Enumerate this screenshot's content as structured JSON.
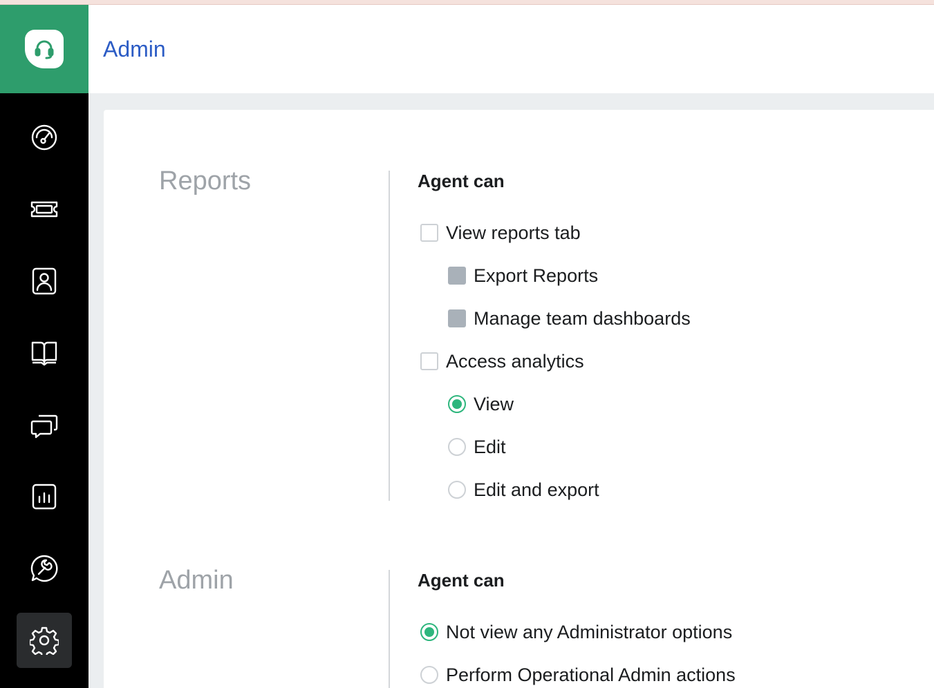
{
  "header": {
    "title": "Admin"
  },
  "sidebar": {
    "items": [
      {
        "icon": "dashboard-icon"
      },
      {
        "icon": "ticket-icon"
      },
      {
        "icon": "contacts-icon"
      },
      {
        "icon": "knowledge-base-icon"
      },
      {
        "icon": "conversations-icon"
      },
      {
        "icon": "analytics-icon"
      },
      {
        "icon": "tools-icon"
      },
      {
        "icon": "gear-icon",
        "active": true
      }
    ]
  },
  "reports_section": {
    "title": "Reports",
    "heading": "Agent can",
    "options": [
      {
        "label": "View reports tab",
        "type": "checkbox",
        "checked": false
      },
      {
        "label": "Export Reports",
        "type": "checkbox",
        "disabled": true
      },
      {
        "label": "Manage team dashboards",
        "type": "checkbox",
        "disabled": true
      },
      {
        "label": "Access analytics",
        "type": "checkbox",
        "checked": false
      },
      {
        "label": "View",
        "type": "radio",
        "checked": true
      },
      {
        "label": "Edit",
        "type": "radio",
        "checked": false
      },
      {
        "label": "Edit and export",
        "type": "radio",
        "checked": false
      }
    ]
  },
  "admin_section": {
    "title": "Admin",
    "heading": "Agent can",
    "options": [
      {
        "label": "Not view any Administrator options",
        "type": "radio",
        "checked": true
      },
      {
        "label": "Perform Operational Admin actions",
        "type": "radio",
        "checked": false
      }
    ]
  },
  "colors": {
    "brand_green": "#2e9d6c",
    "accent_blue": "#2c5cc5",
    "radio_green": "#2eb67d",
    "sidebar_bg": "#000000"
  }
}
